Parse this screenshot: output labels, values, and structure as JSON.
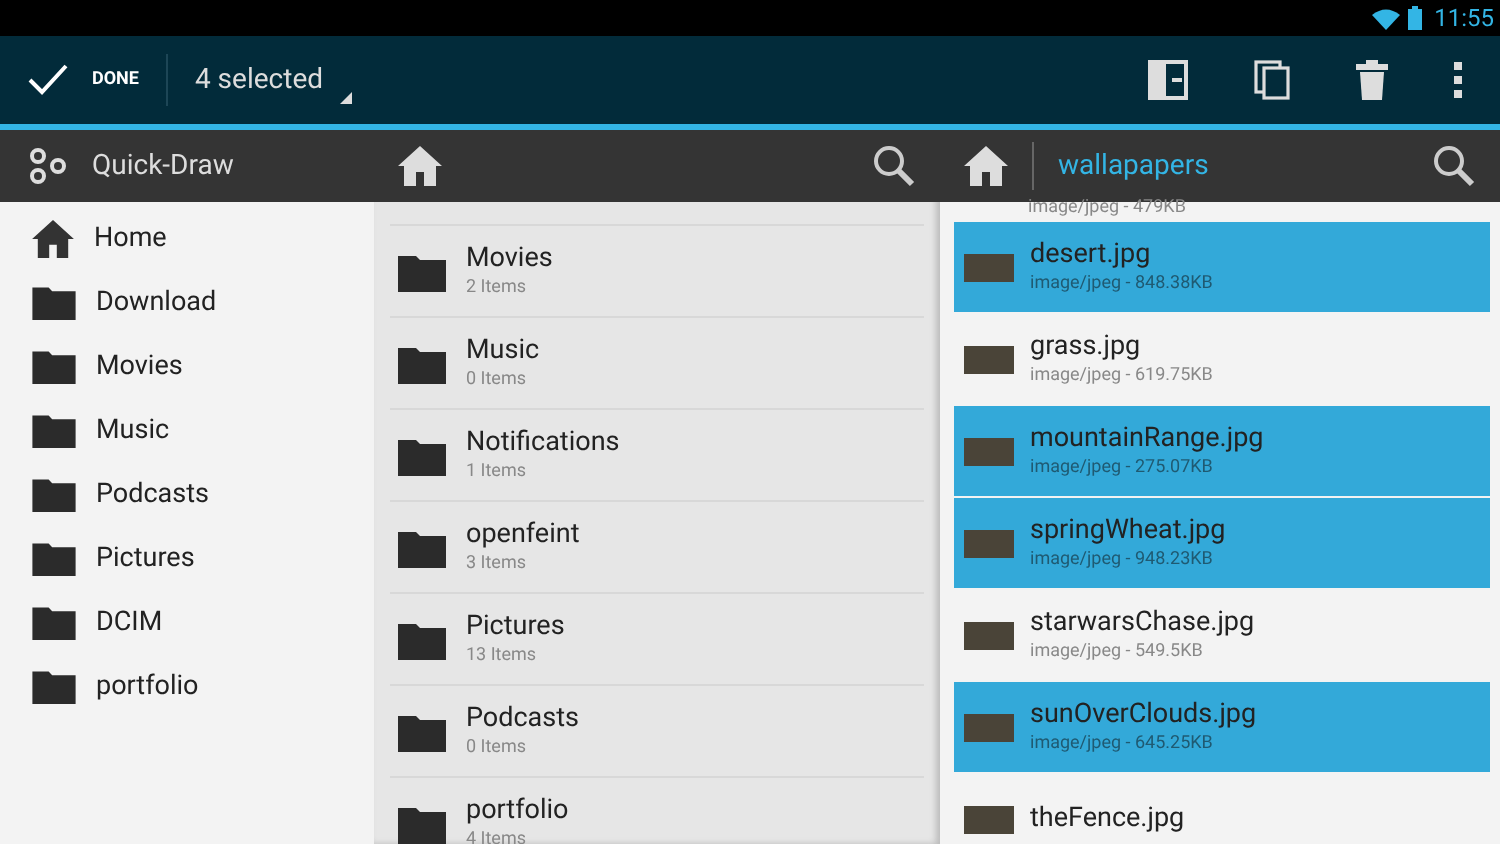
{
  "status_bar": {
    "time": "11:55"
  },
  "action_bar": {
    "done_label": "DONE",
    "selection": "4 selected"
  },
  "sidebar": {
    "title": "Quick-Draw",
    "items": [
      {
        "label": "Home",
        "kind": "home"
      },
      {
        "label": "Download",
        "kind": "folder"
      },
      {
        "label": "Movies",
        "kind": "folder"
      },
      {
        "label": "Music",
        "kind": "folder"
      },
      {
        "label": "Podcasts",
        "kind": "folder"
      },
      {
        "label": "Pictures",
        "kind": "folder"
      },
      {
        "label": "DCIM",
        "kind": "folder"
      },
      {
        "label": "portfolio",
        "kind": "folder"
      }
    ]
  },
  "middle_pane": {
    "items": [
      {
        "name": "Movies",
        "count": "2 Items"
      },
      {
        "name": "Music",
        "count": "0 Items"
      },
      {
        "name": "Notifications",
        "count": "1 Items"
      },
      {
        "name": "openfeint",
        "count": "3 Items"
      },
      {
        "name": "Pictures",
        "count": "13 Items"
      },
      {
        "name": "Podcasts",
        "count": "0 Items"
      },
      {
        "name": "portfolio",
        "count": "4 Items"
      }
    ]
  },
  "right_pane": {
    "path": "wallapapers",
    "top_detail": "image/jpeg - 479KB",
    "files": [
      {
        "name": "desert.jpg",
        "detail": "image/jpeg - 848.38KB",
        "selected": true
      },
      {
        "name": "grass.jpg",
        "detail": "image/jpeg - 619.75KB",
        "selected": false
      },
      {
        "name": "mountainRange.jpg",
        "detail": "image/jpeg - 275.07KB",
        "selected": true
      },
      {
        "name": "springWheat.jpg",
        "detail": "image/jpeg - 948.23KB",
        "selected": true
      },
      {
        "name": "starwarsChase.jpg",
        "detail": "image/jpeg - 549.5KB",
        "selected": false
      },
      {
        "name": "sunOverClouds.jpg",
        "detail": "image/jpeg - 645.25KB",
        "selected": true
      },
      {
        "name": "theFence.jpg",
        "selected": false
      }
    ]
  }
}
